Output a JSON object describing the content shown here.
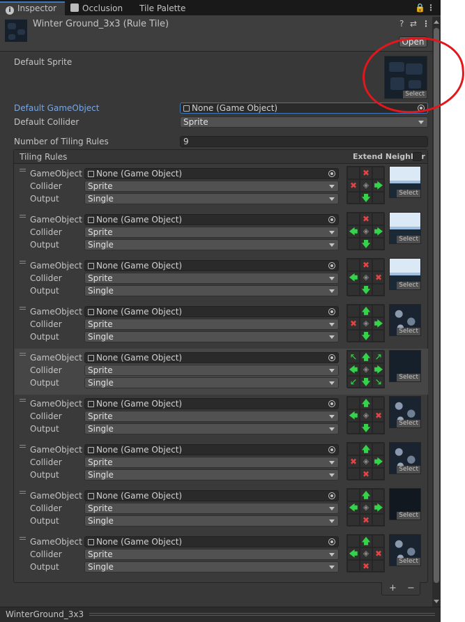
{
  "tabs": [
    {
      "label": "Inspector",
      "icon": "info-icon",
      "active": true
    },
    {
      "label": "Occlusion",
      "active": false
    },
    {
      "label": "Tile Palette",
      "active": false
    }
  ],
  "header": {
    "title": "Winter Ground_3x3 (Rule Tile)",
    "open_button": "Open"
  },
  "default_sprite": {
    "label": "Default Sprite",
    "select_label": "Select"
  },
  "default_gameobject": {
    "label": "Default GameObject",
    "value": "None (Game Object)"
  },
  "default_collider": {
    "label": "Default Collider",
    "value": "Sprite"
  },
  "num_rules": {
    "label": "Number of Tiling Rules",
    "value": "9"
  },
  "tiling_rules": {
    "title": "Tiling Rules",
    "extend_neighbor": "Extend Neighbor",
    "field_labels": {
      "gameobject": "GameObject",
      "collider": "Collider",
      "output": "Output"
    },
    "rules": [
      {
        "gameobject": "None (Game Object)",
        "collider": "Sprite",
        "output": "Single",
        "select": "Select",
        "grid": [
          "",
          "red",
          "",
          "red",
          "center",
          "green-right",
          "",
          "green-down",
          ""
        ],
        "thumb": "snow"
      },
      {
        "gameobject": "None (Game Object)",
        "collider": "Sprite",
        "output": "Single",
        "select": "Select",
        "grid": [
          "",
          "red",
          "",
          "green-left",
          "center",
          "green-right",
          "",
          "green-down",
          ""
        ],
        "thumb": "snow"
      },
      {
        "gameobject": "None (Game Object)",
        "collider": "Sprite",
        "output": "Single",
        "select": "Select",
        "grid": [
          "",
          "red",
          "",
          "green-left",
          "center",
          "red",
          "",
          "green-down",
          ""
        ],
        "thumb": "snow"
      },
      {
        "gameobject": "None (Game Object)",
        "collider": "Sprite",
        "output": "Single",
        "select": "Select",
        "grid": [
          "",
          "green-up",
          "",
          "red",
          "center",
          "green-right",
          "",
          "green-down",
          ""
        ],
        "thumb": "rock"
      },
      {
        "gameobject": "None (Game Object)",
        "collider": "Sprite",
        "output": "Single",
        "select": "Select",
        "grid": [
          "green-upleft",
          "green-up",
          "green-upright",
          "green-left",
          "center",
          "green-right",
          "green-downleft",
          "green-down",
          "green-downright"
        ],
        "thumb": "dark",
        "selected": true
      },
      {
        "gameobject": "None (Game Object)",
        "collider": "Sprite",
        "output": "Single",
        "select": "Select",
        "grid": [
          "",
          "green-up",
          "",
          "green-left",
          "center",
          "red",
          "",
          "green-down",
          ""
        ],
        "thumb": "rock"
      },
      {
        "gameobject": "None (Game Object)",
        "collider": "Sprite",
        "output": "Single",
        "select": "Select",
        "grid": [
          "",
          "green-up",
          "",
          "red",
          "center",
          "green-right",
          "",
          "red",
          ""
        ],
        "thumb": "rock"
      },
      {
        "gameobject": "None (Game Object)",
        "collider": "Sprite",
        "output": "Single",
        "select": "Select",
        "grid": [
          "",
          "green-up",
          "",
          "green-left",
          "center",
          "green-right",
          "",
          "red",
          ""
        ],
        "thumb": "darker"
      },
      {
        "gameobject": "None (Game Object)",
        "collider": "Sprite",
        "output": "Single",
        "select": "Select",
        "grid": [
          "",
          "green-up",
          "",
          "green-left",
          "center",
          "red",
          "",
          "red",
          ""
        ],
        "thumb": "rock"
      }
    ],
    "add": "+",
    "remove": "−"
  },
  "footer": {
    "asset_name": "WinterGround_3x3"
  },
  "colors": {
    "accent": "#3a79bb",
    "neighbor_yes": "#35d34a",
    "neighbor_no": "#e14545",
    "annotation": "#e2171c"
  }
}
